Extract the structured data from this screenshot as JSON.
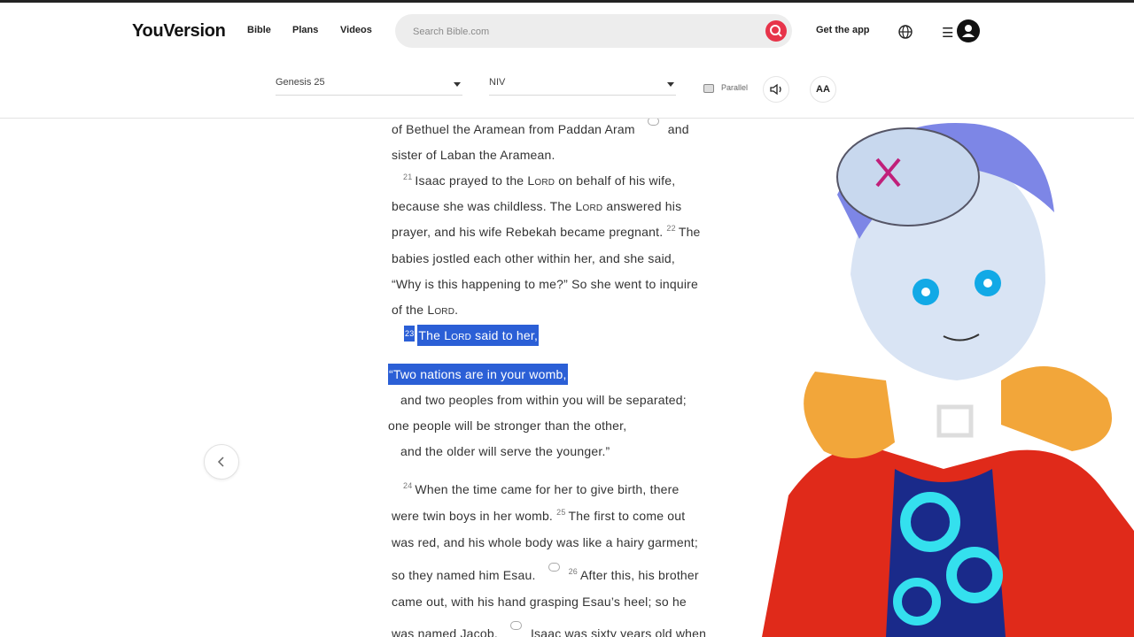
{
  "header": {
    "logo": "YouVersion",
    "nav": [
      "Bible",
      "Plans",
      "Videos"
    ],
    "search_placeholder": "Search Bible.com",
    "get_app": "Get the app"
  },
  "toolbar": {
    "book_chapter": "Genesis 25",
    "version": "NIV",
    "parallel": "Parallel",
    "font_size": "AA"
  },
  "passage": {
    "l1": "of Bethuel the Aramean from Paddan Aram",
    "l1b": "and",
    "l2": "sister of Laban the Aramean.",
    "v21": "21",
    "l3a": "Isaac prayed to the ",
    "lord": "Lord",
    "l3b": " on behalf of his wife,",
    "l4a": "because she was childless. The ",
    "l4b": " answered his",
    "l5": "prayer, and his wife Rebekah became pregnant.",
    "v22": "22",
    "l5b": "The",
    "l6": "babies jostled each other within her, and she said,",
    "l7": "“Why is this happening to me?” So she went to inquire",
    "l8a": "of the ",
    "l8b": ".",
    "v23": "23",
    "l9a": "The ",
    "l9b": " said to her,",
    "p1": "“Two nations are in your womb,",
    "p2": "and two peoples from within you will be separated;",
    "p3": "one people will be stronger than the other,",
    "p4": "and the older will serve the younger.”",
    "v24": "24",
    "l10": "When the time came for her to give birth, there",
    "l11": "were twin boys in her womb.",
    "v25": "25",
    "l11b": "The first to come out",
    "l12": "was red, and his whole body was like a hairy garment;",
    "l13": "so they named him Esau.",
    "v26": "26",
    "l13b": "After this, his brother",
    "l14": "came out, with his hand grasping Esau’s heel; so he",
    "l15": "was named Jacob.",
    "l15b": "Isaac was sixty years old when"
  },
  "colors": {
    "accent": "#e7344a",
    "highlight": "#2b5fd6"
  },
  "icons": [
    "search-icon",
    "globe-icon",
    "menu-icon",
    "user-icon",
    "chevron-left-icon",
    "speaker-icon",
    "note-icon"
  ]
}
